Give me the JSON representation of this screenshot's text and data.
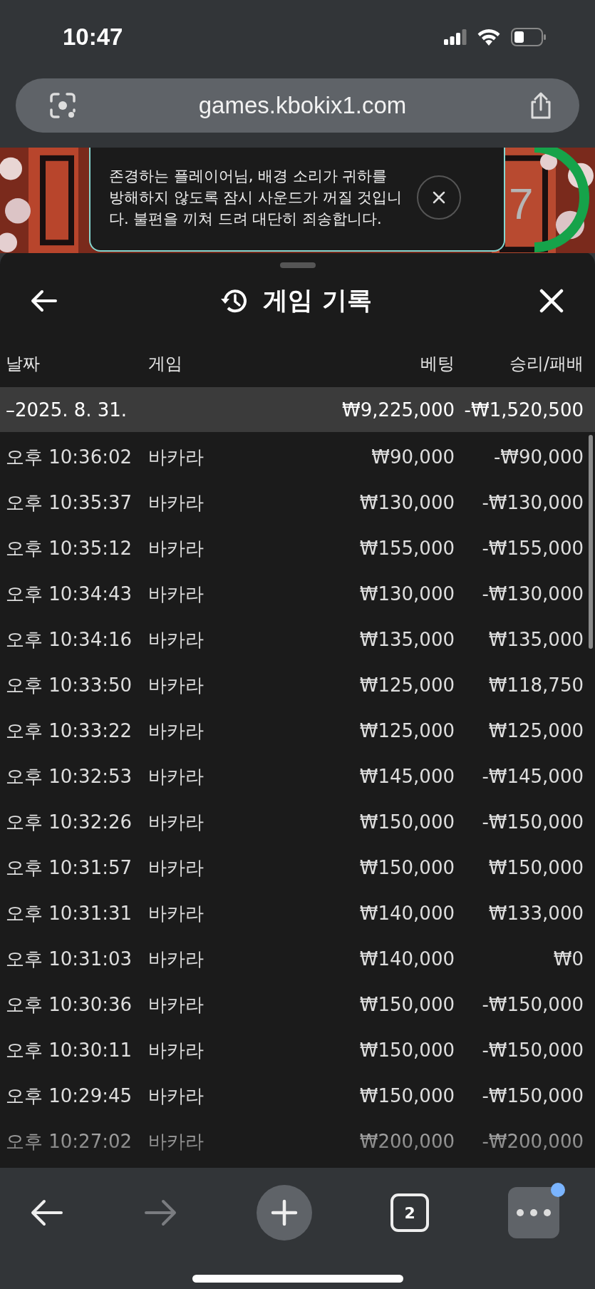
{
  "status_bar": {
    "time": "10:47"
  },
  "browser": {
    "url": "games.kbokix1.com",
    "tab_count": "2",
    "forward_disabled": true,
    "menu_badge": true
  },
  "game": {
    "timer_digit": "7",
    "toast": {
      "message": "존경하는 플레이어님, 배경 소리가 귀하를 방해하지 않도록 잠시 사운드가 꺼질 것입니다. 불편을 끼쳐 드려 대단히 죄송합니다."
    }
  },
  "sheet": {
    "title": "게임 기록",
    "table": {
      "columns": [
        "날짜",
        "게임",
        "베팅",
        "승리/패배"
      ],
      "summary": {
        "date": "–2025. 8. 31.",
        "bet": "₩9,225,000",
        "result": "-₩1,520,500"
      },
      "rows": [
        {
          "time": "오후 10:36:02",
          "game": "바카라",
          "bet": "₩90,000",
          "result": "-₩90,000"
        },
        {
          "time": "오후 10:35:37",
          "game": "바카라",
          "bet": "₩130,000",
          "result": "-₩130,000"
        },
        {
          "time": "오후 10:35:12",
          "game": "바카라",
          "bet": "₩155,000",
          "result": "-₩155,000"
        },
        {
          "time": "오후 10:34:43",
          "game": "바카라",
          "bet": "₩130,000",
          "result": "-₩130,000"
        },
        {
          "time": "오후 10:34:16",
          "game": "바카라",
          "bet": "₩135,000",
          "result": "₩135,000"
        },
        {
          "time": "오후 10:33:50",
          "game": "바카라",
          "bet": "₩125,000",
          "result": "₩118,750"
        },
        {
          "time": "오후 10:33:22",
          "game": "바카라",
          "bet": "₩125,000",
          "result": "₩125,000"
        },
        {
          "time": "오후 10:32:53",
          "game": "바카라",
          "bet": "₩145,000",
          "result": "-₩145,000"
        },
        {
          "time": "오후 10:32:26",
          "game": "바카라",
          "bet": "₩150,000",
          "result": "-₩150,000"
        },
        {
          "time": "오후 10:31:57",
          "game": "바카라",
          "bet": "₩150,000",
          "result": "₩150,000"
        },
        {
          "time": "오후 10:31:31",
          "game": "바카라",
          "bet": "₩140,000",
          "result": "₩133,000"
        },
        {
          "time": "오후 10:31:03",
          "game": "바카라",
          "bet": "₩140,000",
          "result": "₩0"
        },
        {
          "time": "오후 10:30:36",
          "game": "바카라",
          "bet": "₩150,000",
          "result": "-₩150,000"
        },
        {
          "time": "오후 10:30:11",
          "game": "바카라",
          "bet": "₩150,000",
          "result": "-₩150,000"
        },
        {
          "time": "오후 10:29:45",
          "game": "바카라",
          "bet": "₩150,000",
          "result": "-₩150,000"
        },
        {
          "time": "오후 10:27:02",
          "game": "바카라",
          "bet": "₩200,000",
          "result": "-₩200,000"
        }
      ]
    }
  }
}
